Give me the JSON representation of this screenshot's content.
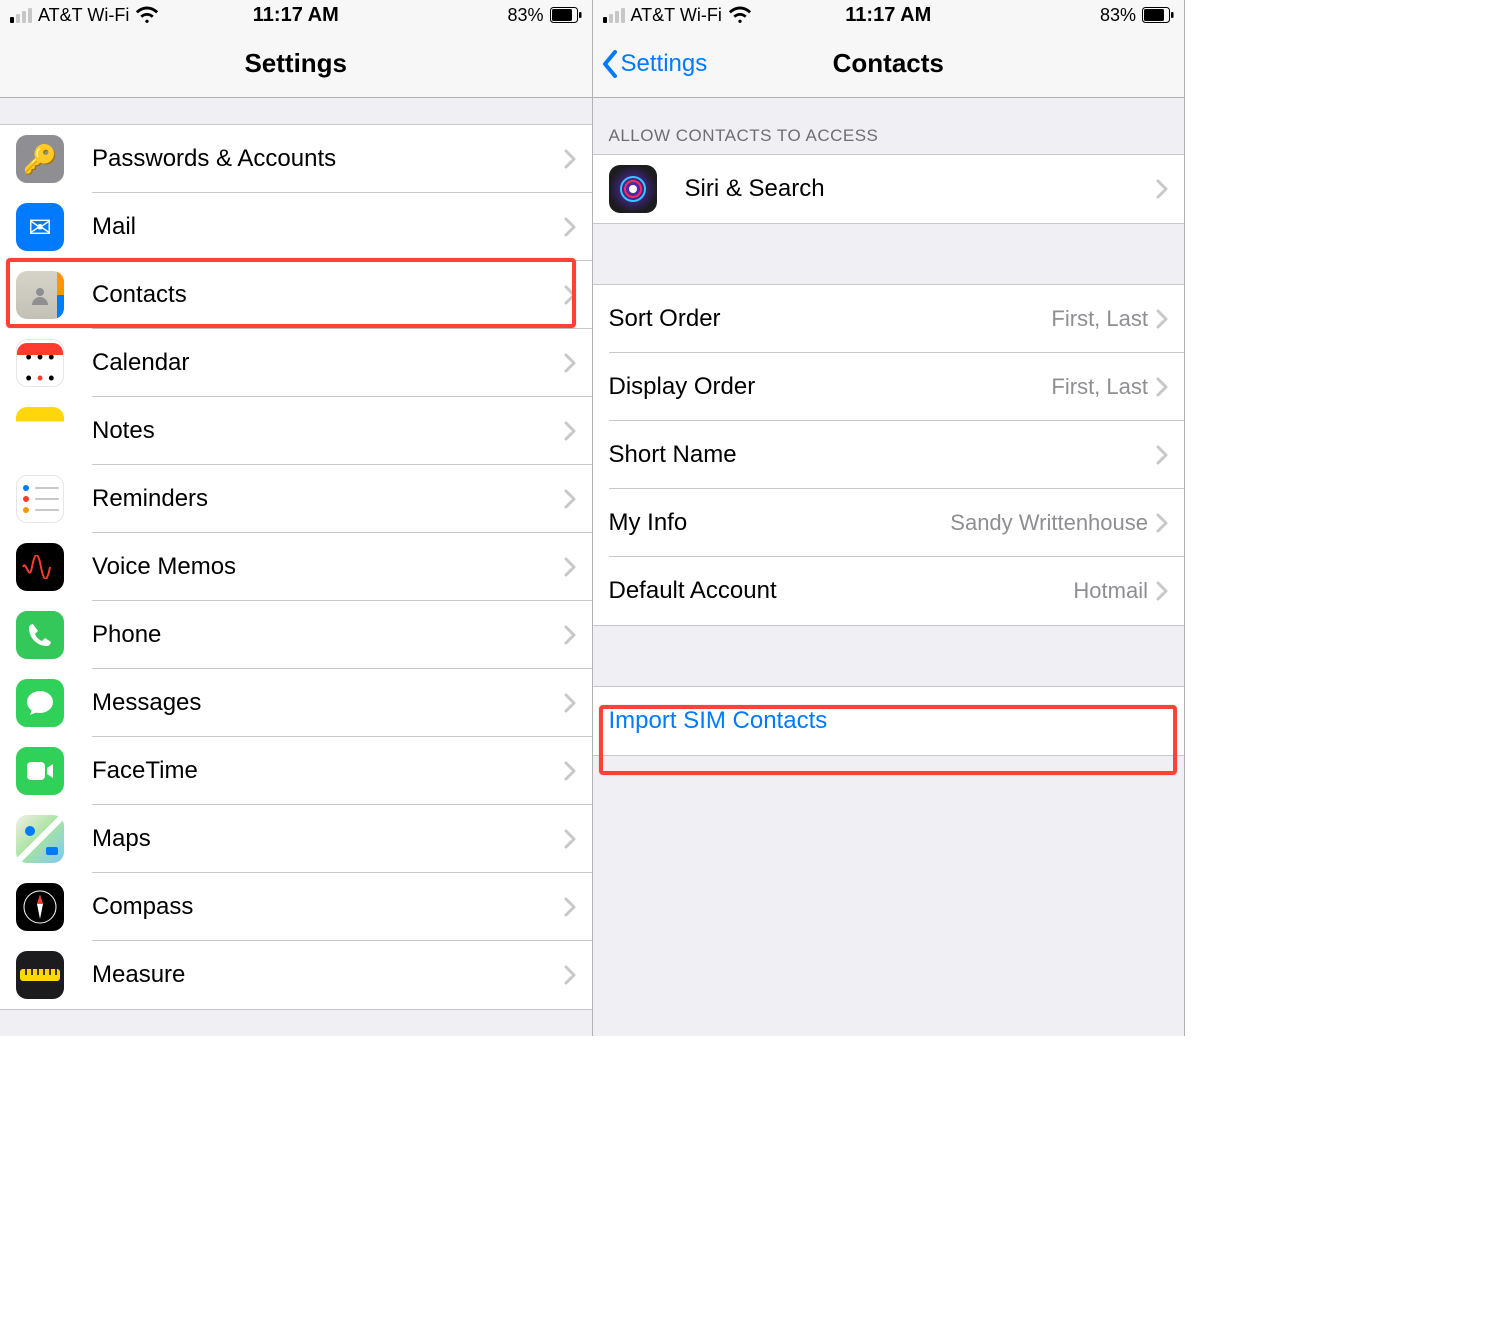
{
  "left": {
    "status": {
      "carrier": "AT&T Wi-Fi",
      "time": "11:17 AM",
      "battery": "83%"
    },
    "title": "Settings",
    "items": [
      {
        "label": "Passwords & Accounts",
        "icon": "key-icon"
      },
      {
        "label": "Mail",
        "icon": "mail-icon"
      },
      {
        "label": "Contacts",
        "icon": "contacts-icon"
      },
      {
        "label": "Calendar",
        "icon": "calendar-icon"
      },
      {
        "label": "Notes",
        "icon": "notes-icon"
      },
      {
        "label": "Reminders",
        "icon": "reminders-icon"
      },
      {
        "label": "Voice Memos",
        "icon": "voicememos-icon"
      },
      {
        "label": "Phone",
        "icon": "phone-icon"
      },
      {
        "label": "Messages",
        "icon": "messages-icon"
      },
      {
        "label": "FaceTime",
        "icon": "facetime-icon"
      },
      {
        "label": "Maps",
        "icon": "maps-icon"
      },
      {
        "label": "Compass",
        "icon": "compass-icon"
      },
      {
        "label": "Measure",
        "icon": "measure-icon"
      }
    ]
  },
  "right": {
    "status": {
      "carrier": "AT&T Wi-Fi",
      "time": "11:17 AM",
      "battery": "83%"
    },
    "back_label": "Settings",
    "title": "Contacts",
    "section_header": "ALLOW CONTACTS TO ACCESS",
    "access": [
      {
        "label": "Siri & Search",
        "icon": "siri-icon"
      }
    ],
    "settings": [
      {
        "label": "Sort Order",
        "value": "First, Last"
      },
      {
        "label": "Display Order",
        "value": "First, Last"
      },
      {
        "label": "Short Name",
        "value": ""
      },
      {
        "label": "My Info",
        "value": "Sandy Writtenhouse"
      },
      {
        "label": "Default Account",
        "value": "Hotmail"
      }
    ],
    "action_label": "Import SIM Contacts"
  }
}
